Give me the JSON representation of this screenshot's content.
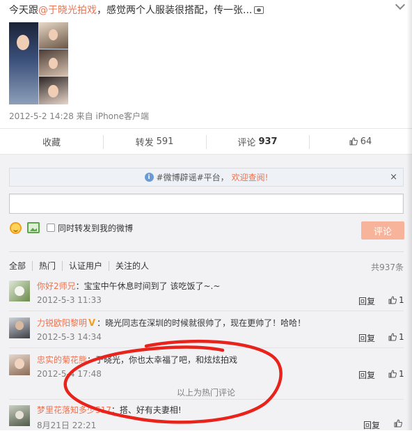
{
  "post": {
    "text_before": "今天跟",
    "mention": "@于晓光拍戏",
    "text_after": "，感觉两个人服装很搭配，传一张...",
    "meta": "2012-5-2 14:28 来自 iPhone客户端"
  },
  "actions": {
    "favorite": "收藏",
    "repost_label": "转发",
    "repost_count": "591",
    "comment_label": "评论",
    "comment_count": "937",
    "like_count": "64"
  },
  "notice": {
    "text": "#微博辟谣#平台，",
    "link": "欢迎查阅!",
    "close": "×"
  },
  "composer": {
    "input_value": "",
    "repost_option": "同时转发到我的微博",
    "submit": "评论"
  },
  "filters": {
    "tabs": [
      "全部",
      "热门",
      "认证用户",
      "关注的人"
    ],
    "total": "共937条"
  },
  "comments": [
    {
      "user": "你好2师兄",
      "text": "：宝宝中午休息时间到了 该吃饭了~.~",
      "time": "2012-5-3 11:33",
      "reply": "回复",
      "likes": "1"
    },
    {
      "user": "力锐欧阳黎明",
      "badge": "V",
      "text": "：晓光同志在深圳的时候就很帅了，现在更帅了！哈哈！",
      "time": "2012-5-3 14:34",
      "reply": "回复",
      "likes": "1"
    },
    {
      "user": "忠实的菊花熊",
      "text": "：于晓光，你也太幸福了吧，和炫炫拍戏",
      "time": "2012-5-4 17:48",
      "reply": "回复",
      "likes": "1"
    },
    {
      "user": "梦里花落知多少517",
      "text": "：搭、好有夫妻相!",
      "time": "8月21日 22:21",
      "reply": "回复",
      "likes": ""
    }
  ],
  "hot_end": "以上为热门评论",
  "colors": {
    "accent": "#eb7350",
    "submit_bg": "#f7b49a",
    "annotation": "#e8231b"
  }
}
